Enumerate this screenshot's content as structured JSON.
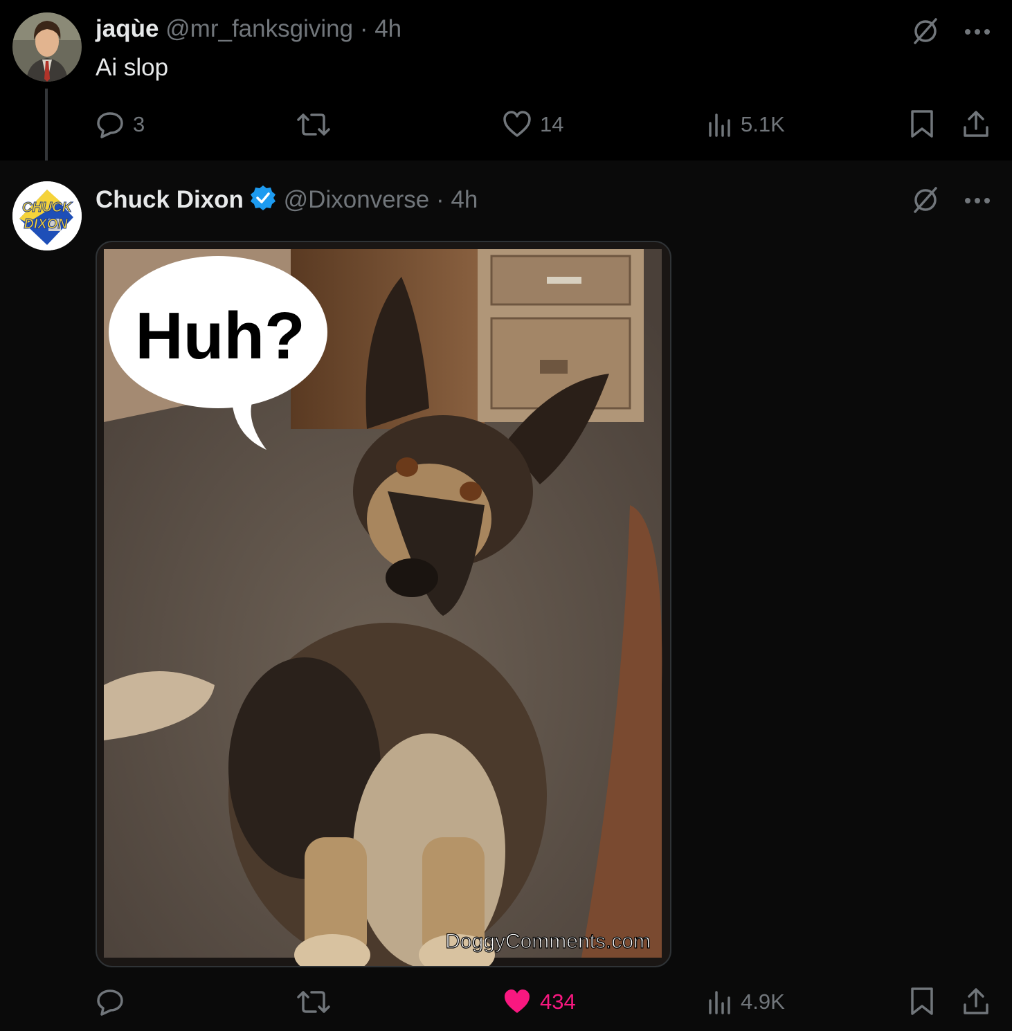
{
  "tweets": [
    {
      "author_name": "jaqùe",
      "handle": "@mr_fanksgiving",
      "separator": "·",
      "time": "4h",
      "text": "Ai slop",
      "stats": {
        "replies": "3",
        "retweets": "",
        "likes": "14",
        "views": "5.1K"
      },
      "liked": false
    },
    {
      "author_name": "Chuck Dixon",
      "verified": true,
      "handle": "@Dixonverse",
      "separator": "·",
      "time": "4h",
      "media": {
        "speech_bubble_text": "Huh?",
        "watermark": "DoggyComments.com"
      },
      "stats": {
        "replies": "",
        "retweets": "",
        "likes": "434",
        "views": "4.9K"
      },
      "liked": true
    }
  ],
  "avatar_logo": {
    "line1": "CHUCK",
    "line2": "DIXON"
  },
  "colors": {
    "background": "#0a0a0a",
    "text_primary": "#e7e9ea",
    "text_secondary": "#71767b",
    "verified_blue": "#1d9bf0",
    "like_pink": "#f91880"
  },
  "icons": [
    "reply-icon",
    "retweet-icon",
    "like-icon",
    "views-icon",
    "bookmark-icon",
    "share-icon",
    "grok-icon",
    "more-icon",
    "verified-badge-icon"
  ]
}
